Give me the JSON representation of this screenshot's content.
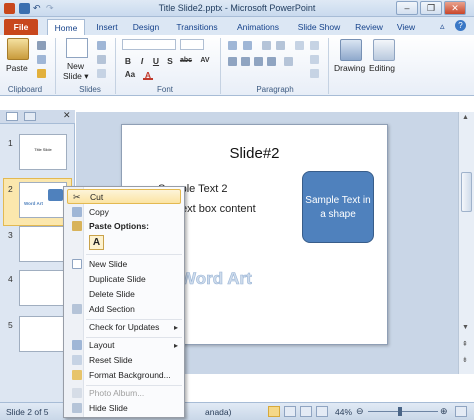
{
  "window": {
    "title": "Title Slide2.pptx - Microsoft PowerPoint",
    "controls": [
      "–",
      "❐",
      "✕"
    ]
  },
  "tabs": [
    "File",
    "Home",
    "Insert",
    "Design",
    "Transitions",
    "Animations",
    "Slide Show",
    "Review",
    "View"
  ],
  "ribbon": {
    "groups": [
      "Clipboard",
      "Slides",
      "Font",
      "Paragraph"
    ],
    "paste_label": "Paste",
    "new_slide_label": "New",
    "new_slide_label2": "Slide ▾",
    "drawing_label": "Drawing",
    "editing_label": "Editing",
    "format_buttons": [
      "B",
      "I",
      "U",
      "S",
      "abc",
      "AV",
      "Aa",
      "A"
    ]
  },
  "thumbnails": [
    {
      "num": "1",
      "text": "Title Slide"
    },
    {
      "num": "2",
      "text": "Word Art"
    },
    {
      "num": "3",
      "text": ""
    },
    {
      "num": "4",
      "text": ""
    },
    {
      "num": "5",
      "text": ""
    }
  ],
  "slide": {
    "title": "Slide#2",
    "bullet1": "Sample Text 2",
    "bullet2": "text box content",
    "shape_text": "Sample Text in a shape",
    "word_art": "Word Art"
  },
  "context_menu": {
    "items": [
      {
        "label": "Cut",
        "icon": "scissors-icon"
      },
      {
        "label": "Copy",
        "icon": "copy-icon"
      },
      {
        "label": "Paste Options:",
        "icon": "clipboard-icon"
      },
      {
        "label": "A",
        "icon": "paste-keep-text-icon"
      },
      {
        "label": "New Slide",
        "icon": "new-slide-icon"
      },
      {
        "label": "Duplicate Slide",
        "icon": ""
      },
      {
        "label": "Delete Slide",
        "icon": ""
      },
      {
        "label": "Add Section",
        "icon": "section-icon"
      },
      {
        "label": "Check for Updates",
        "icon": ""
      },
      {
        "label": "Layout",
        "icon": "layout-icon"
      },
      {
        "label": "Reset Slide",
        "icon": "reset-icon"
      },
      {
        "label": "Format Background...",
        "icon": "format-background-icon"
      },
      {
        "label": "Photo Album...",
        "icon": "photo-album-icon"
      },
      {
        "label": "Hide Slide",
        "icon": "hide-slide-icon"
      }
    ]
  },
  "status": {
    "slide_of": "Slide 2 of 5",
    "lang": "anada)",
    "zoom": "44%"
  },
  "colors": {
    "file_tab": "#c8471d",
    "shape_fill": "#4f81bd",
    "menu_highlight": "#fbe4a4"
  }
}
